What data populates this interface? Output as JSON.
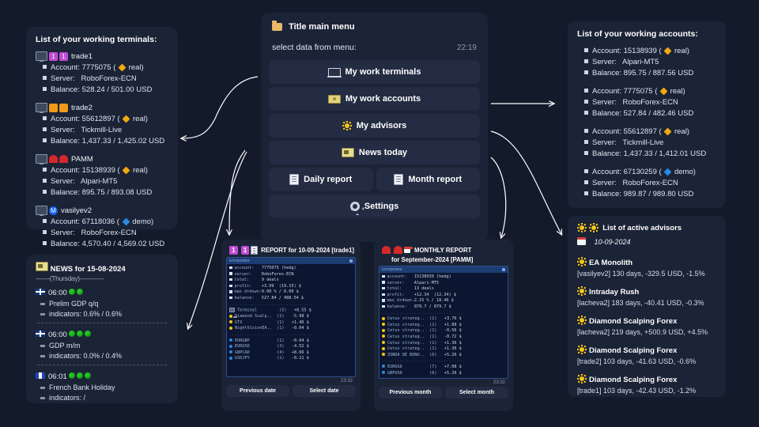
{
  "terminals_panel": {
    "title": "List of your working terminals:",
    "items": [
      {
        "name": "trade1",
        "badges": [
          "purple-1",
          "purple-1"
        ],
        "account_label": "Account:",
        "account": "7775075",
        "account_type": "real",
        "type_color": "#f0a90c",
        "server_label": "Server:",
        "server": "RoboForex-ECN",
        "balance_label": "Balance:",
        "balance": "528.24 / 501.00 USD"
      },
      {
        "name": "trade2",
        "badges": [
          "orange-wave",
          "orange-wave"
        ],
        "account_label": "Account:",
        "account": "55612897",
        "account_type": "real",
        "type_color": "#f0a90c",
        "server_label": "Server:",
        "server": "Tickmill-Live",
        "balance_label": "Balance:",
        "balance": "1,437.33 / 1,425.02 USD"
      },
      {
        "name": "PAMM",
        "badges": [
          "red-arc",
          "red-arc"
        ],
        "account_label": "Account:",
        "account": "15138939",
        "account_type": "real",
        "type_color": "#f0a90c",
        "server_label": "Server:",
        "server": "Alpari-MT5",
        "balance_label": "Balance:",
        "balance": "895.75 / 893.08 USD"
      },
      {
        "name": "vasilyev2",
        "badges": [
          "blue-m"
        ],
        "account_label": "Account:",
        "account": "67118036",
        "account_type": "demo",
        "type_color": "#2a8ae0",
        "server_label": "Server:",
        "server": "RoboForex-ECN",
        "balance_label": "Balance:",
        "balance": "4,570.40 / 4,569.02 USD"
      }
    ]
  },
  "news_panel": {
    "title": "NEWS for 15-08-2024",
    "dashes": "-------(Thursday)------------",
    "items": [
      {
        "flag": "uk",
        "time": "06:00",
        "dots": 2,
        "headline": "Prelim GDP q/q",
        "indicators": "indicators: 0.6% / 0.6%"
      },
      {
        "flag": "uk",
        "time": "06:00",
        "dots": 3,
        "headline": "GDP m/m",
        "indicators": "indicators: 0.0% / 0.4%"
      },
      {
        "flag": "fr",
        "time": "06:01",
        "dots": 3,
        "headline": "French Bank Holiday",
        "indicators": "indicators: /"
      }
    ]
  },
  "main_menu": {
    "title": "Title main menu",
    "subtitle": "select data from menu:",
    "clock": "22:19",
    "buttons": [
      {
        "label": "My work terminals",
        "icon": "laptop-icon"
      },
      {
        "label": "My work accounts",
        "icon": "money-icon"
      },
      {
        "label": "My advisors",
        "icon": "sun-icon"
      },
      {
        "label": "News today",
        "icon": "news-icon"
      }
    ],
    "row_buttons": [
      {
        "label": "Daily report",
        "icon": "document-icon"
      },
      {
        "label": "Month report",
        "icon": "document-icon"
      }
    ],
    "settings": {
      "label": "Settings",
      "icon": "gear-icon"
    }
  },
  "accounts_panel": {
    "title": "List of your working accounts:",
    "items": [
      {
        "account_label": "Account:",
        "account": "15138939",
        "account_type": "real",
        "type_color": "#f0a90c",
        "server_label": "Server:",
        "server": "Alpari-MT5",
        "balance_label": "Balance:",
        "balance": "895.75 / 887.56 USD"
      },
      {
        "account_label": "Account:",
        "account": "7775075",
        "account_type": "real",
        "type_color": "#f0a90c",
        "server_label": "Server:",
        "server": "RoboForex-ECN",
        "balance_label": "Balance:",
        "balance": "527.84 / 482.46 USD"
      },
      {
        "account_label": "Account:",
        "account": "55612897",
        "account_type": "real",
        "type_color": "#f0a90c",
        "server_label": "Server:",
        "server": "Tickmill-Live",
        "balance_label": "Balance:",
        "balance": "1,437.33 / 1,412.01 USD"
      },
      {
        "account_label": "Account:",
        "account": "67130259",
        "account_type": "demo",
        "type_color": "#2a8ae0",
        "server_label": "Server:",
        "server": "RoboForex-ECN",
        "balance_label": "Balance:",
        "balance": "989.87 / 989.80 USD"
      }
    ]
  },
  "advisors_panel": {
    "title": "List of active advisors",
    "date": "10-09-2024",
    "items": [
      {
        "name": "EA Monolith",
        "stats": "[vasilyev2] 130 days, -329.5 USD, -1.5%"
      },
      {
        "name": "Intraday Rush",
        "stats": "[lacheva2] 183 days, -40.41 USD, -0.3%"
      },
      {
        "name": "Diamond Scalping Forex",
        "stats": "[lacheva2] 219 days, +500.9 USD, +4.5%"
      },
      {
        "name": "Diamond Scalping Forex",
        "stats": "[trade2] 103 days, -41.63 USD, -0.6%"
      },
      {
        "name": "Diamond Scalping Forex",
        "stats": "[trade1] 103 days, -42.43 USD, -1.2%"
      }
    ]
  },
  "daily_report": {
    "header": "REPORT for 10-09-2024 [trade1]",
    "terminal_bar": "котировки",
    "summary": [
      {
        "label": "account:",
        "value": "7775075 (hedg)"
      },
      {
        "label": "server:",
        "value": "RoboForex-ECN"
      },
      {
        "label": "total:",
        "value": "9 deals"
      },
      {
        "label": "profit:",
        "value": "+3.99  (19.15) $"
      },
      {
        "label": "max drdown:",
        "value": "0.00 % / 0.00 $"
      },
      {
        "label": "balance:",
        "value": "527.84 / 488.54 $"
      }
    ],
    "strategies": [
      {
        "icon": "monitor",
        "name": "Terminal",
        "count": "(5)",
        "value": "+8.55 $"
      },
      {
        "icon": "sun",
        "name": "Diamond Scalp..",
        "count": "(1)",
        "value": "-5.98 $"
      },
      {
        "icon": "sun",
        "name": "GTX",
        "count": "(1)",
        "value": "+1.46 $"
      },
      {
        "icon": "sun",
        "name": "NightVisionEA..",
        "count": "(1)",
        "value": "-0.04 $"
      }
    ],
    "symbols": [
      {
        "icon": "blue",
        "name": "EURGBP",
        "count": "(1)",
        "value": "-0.04 $"
      },
      {
        "icon": "blue",
        "name": "EURUSD",
        "count": "(3)",
        "value": "-4.52 $"
      },
      {
        "icon": "blue",
        "name": "GBPCAD",
        "count": "(4)",
        "value": "+8.66 $"
      },
      {
        "icon": "blue",
        "name": "USDJPY",
        "count": "(1)",
        "value": "-0.11 $"
      }
    ],
    "time": "23:32",
    "buttons": [
      "Previous date",
      "Select date"
    ]
  },
  "monthly_report": {
    "header": "MONTHLY REPORT",
    "header2": "for September-2024 [PAMM]",
    "terminal_bar": "котировки",
    "summary": [
      {
        "label": "account:",
        "value": "15138939 (hedg)"
      },
      {
        "label": "server:",
        "value": "Alpari-MT5"
      },
      {
        "label": "total:",
        "value": "13 deals"
      },
      {
        "label": "profit:",
        "value": "+12.34  (12.34) $"
      },
      {
        "label": "max drdown:",
        "value": "2.15 % / 18.46 $"
      },
      {
        "label": "balance:",
        "value": "879.7 / 879.7 $"
      }
    ],
    "strategies": [
      {
        "icon": "sun",
        "name": "Cetus strateg..",
        "count": "(2)",
        "value": "+3.76 $"
      },
      {
        "icon": "sun",
        "name": "Cetus strateg..",
        "count": "(1)",
        "value": "+1.88 $"
      },
      {
        "icon": "sun",
        "name": "Cetus strateg..",
        "count": "(1)",
        "value": "-0.56 $"
      },
      {
        "icon": "sun",
        "name": "Cetus strateg..",
        "count": "(1)",
        "value": "-0.72 $"
      },
      {
        "icon": "sun",
        "name": "Cetus strateg..",
        "count": "(1)",
        "value": "+1.36 $"
      },
      {
        "icon": "sun",
        "name": "Cetus strateg..",
        "count": "(1)",
        "value": "+1.36 $"
      },
      {
        "icon": "sun",
        "name": "ZONDA QE BONU..",
        "count": "(6)",
        "value": "+5.26 $"
      }
    ],
    "symbols": [
      {
        "icon": "blue",
        "name": "EURUSD",
        "count": "(7)",
        "value": "+7.08 $"
      },
      {
        "icon": "blue",
        "name": "GBPUSD",
        "count": "(6)",
        "value": "+5.26 $"
      }
    ],
    "time": "23:32",
    "buttons": [
      "Previous month",
      "Select month"
    ]
  }
}
